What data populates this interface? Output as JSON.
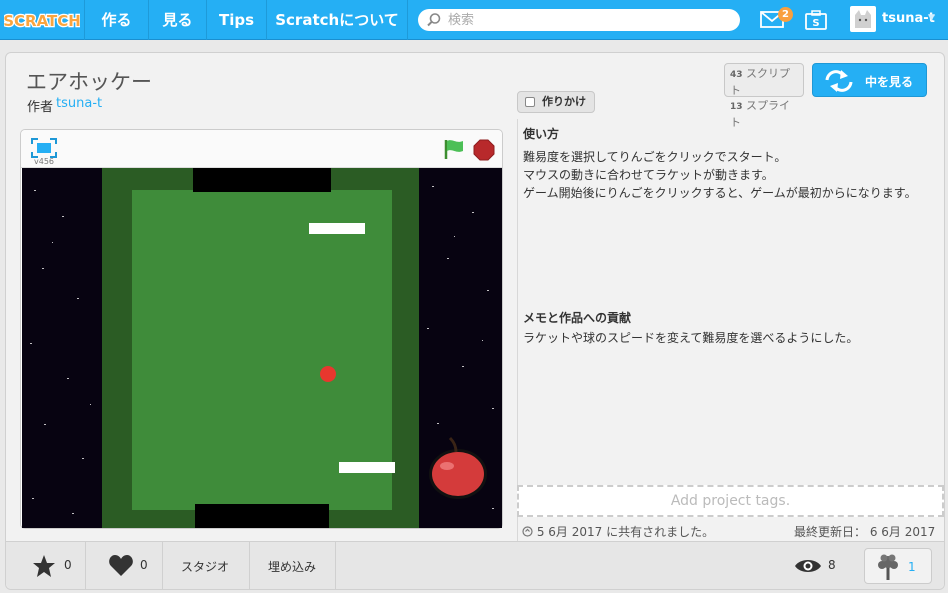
{
  "nav": {
    "logo_text": "SCRATCH",
    "items": [
      "作る",
      "見る",
      "Tips",
      "Scratchについて"
    ],
    "search_placeholder": "検索",
    "messages_count": "2",
    "username": "tsuna-t"
  },
  "project": {
    "title": "エアホッケー",
    "author_label": "作者",
    "author": "tsuna-t",
    "wip_label": "作りかけ",
    "scripts_count": "43",
    "scripts_label": "スクリプト",
    "sprites_count": "13",
    "sprites_label": "スプライト",
    "see_inside": "中を見る",
    "player_version": "v456"
  },
  "instructions": {
    "heading": "使い方",
    "body": "難易度を選択してりんごをクリックでスタート。\nマウスの動きに合わせてラケットが動きます。\nゲーム開始後にりんごをクリックすると、ゲームが最初からになります。"
  },
  "notes": {
    "heading": "メモと作品への貢献",
    "body": "ラケットや球のスピードを変えて難易度を選べるようにした。"
  },
  "tags_placeholder": "Add project tags.",
  "shared_text": "5 6月 2017 に共有されました。",
  "modified_text": "最終更新日： 6 6月 2017",
  "footer": {
    "favorites": "0",
    "loves": "0",
    "studio": "スタジオ",
    "embed": "埋め込み",
    "views": "8",
    "remixes": "1"
  },
  "colors": {
    "nav_blue": "#25aff4",
    "field_dark": "#2b5c24",
    "field_light": "#3f8c3a",
    "space": "#070311",
    "apple": "#d43b3b",
    "ball": "#e8372e"
  }
}
